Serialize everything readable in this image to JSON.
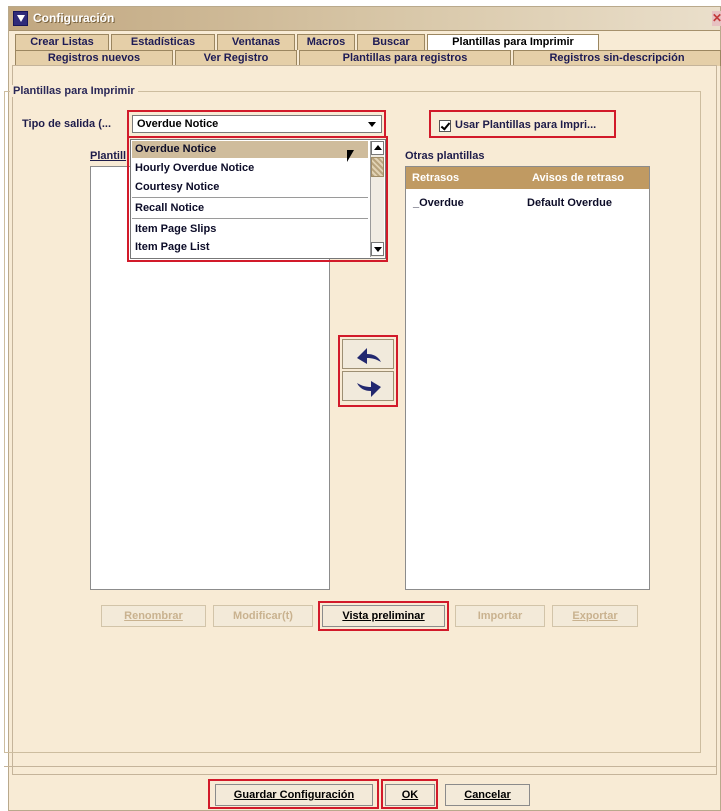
{
  "window": {
    "title": "Configuración"
  },
  "tabs_row1": [
    {
      "label": "Crear Listas"
    },
    {
      "label": "Estadísticas"
    },
    {
      "label": "Ventanas"
    },
    {
      "label": "Macros"
    },
    {
      "label": "Buscar"
    },
    {
      "label": "Plantillas para Imprimir",
      "active": true
    }
  ],
  "tabs_row2": [
    {
      "label": "Registros nuevos"
    },
    {
      "label": "Ver Registro"
    },
    {
      "label": "Plantillas para registros"
    },
    {
      "label": "Registros sin-descripción"
    }
  ],
  "group": {
    "label": "Plantillas para Imprimir"
  },
  "output_type": {
    "label": "Tipo de salida (...",
    "selected": "Overdue Notice",
    "options": [
      "Overdue Notice",
      "Hourly Overdue Notice",
      "Courtesy Notice",
      "Recall Notice",
      "Item Page Slips",
      "Item Page List"
    ]
  },
  "use_templates": {
    "label": "Usar Plantillas para Impri...",
    "checked": true
  },
  "left_list": {
    "label": "Plantill"
  },
  "other_templates": {
    "label": "Otras plantillas",
    "columns": [
      "Retrasos",
      "Avisos de retraso"
    ],
    "rows": [
      [
        "_Overdue",
        "Default Overdue"
      ]
    ]
  },
  "buttons": {
    "rename": "Renombrar",
    "modify": "Modificar(t)",
    "preview": "Vista preliminar",
    "import": "Importar",
    "export": "Exportar",
    "save": "Guardar Configuración",
    "ok": "OK",
    "cancel": "Cancelar"
  },
  "colors": {
    "window_bg": "#f8ebd5",
    "header_bg": "#c09a62",
    "highlight": "#d21a2a",
    "arrow": "#22286f"
  }
}
